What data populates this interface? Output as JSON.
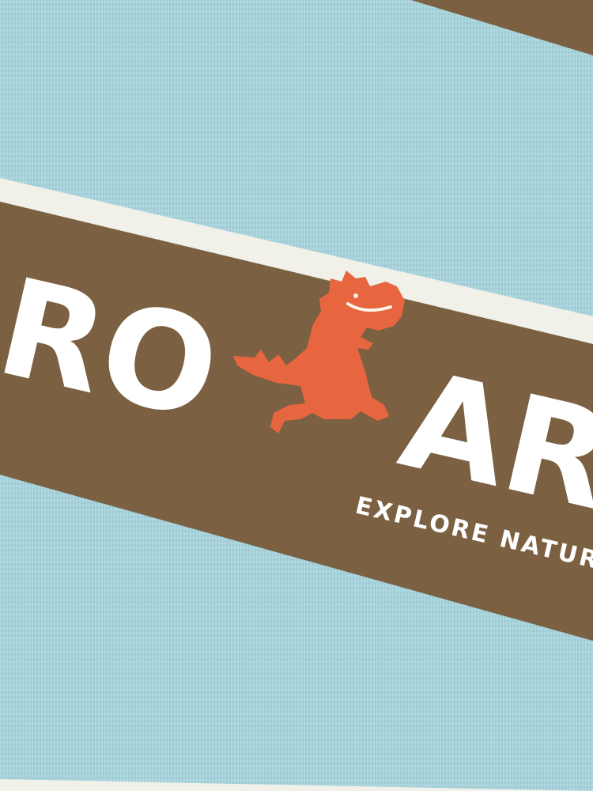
{
  "print": {
    "word_left": "RO",
    "word_right": "AR",
    "tagline": "EXPLORE NATUR"
  },
  "colors": {
    "light_blue_stripe": "#a9d6df",
    "brown_stripe": "#7b6141",
    "white_pinstripe": "#f1f1ea",
    "print_white": "#ffffff",
    "dinosaur_orange": "#e8663f"
  },
  "icons": [
    "dinosaur-icon"
  ]
}
